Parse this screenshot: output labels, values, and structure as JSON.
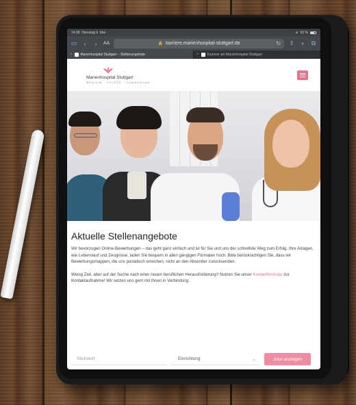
{
  "browser": {
    "status_time": "14:38",
    "status_date": "Dienstag 6. Mai",
    "status_battery": "62 %",
    "toolbar_left_label": "AA",
    "url": "karriere.marienhospital-stuttgart.de",
    "tabs": [
      {
        "label": "Marienhospital Stuttgart – Stellenangebote"
      },
      {
        "label": "Karriere am Marienhospital Stuttgart"
      }
    ]
  },
  "site": {
    "logo_name": "Marienhospital Stuttgart",
    "logo_tagline": "MEDIZIN · PFLEGE · ZUWENDUNG",
    "brand_color": "#e8738f"
  },
  "content": {
    "headline": "Aktuelle Stellenangebote",
    "para1": "Wir bevorzugen Online-Bewerbungen – das geht ganz einfach und ist für Sie und uns der schnellste Weg zum Erfolg. Ihre Anlagen, wie Lebenslauf und Zeugnisse, laden Sie bequem in allen gängigen Formaten hoch. Bitte berücksichtigen Sie, dass wir Bewerbungsmappen, die uns postalisch erreichen, nicht an den Absender zurücksenden.",
    "para2_a": "Wenig Zeit, aber auf der Suche nach einer neuen beruflichen Herausforderung? Nutzen Sie unser",
    "para2_link": "Kontaktformular",
    "para2_b": "zur Kontaktaufnahme! Wir setzen uns gern mit Ihnen in Verbindung."
  },
  "search": {
    "keyword_placeholder": "Stichwort",
    "select_value": "Einrichtung",
    "submit_label": "Jobs anzeigen"
  }
}
